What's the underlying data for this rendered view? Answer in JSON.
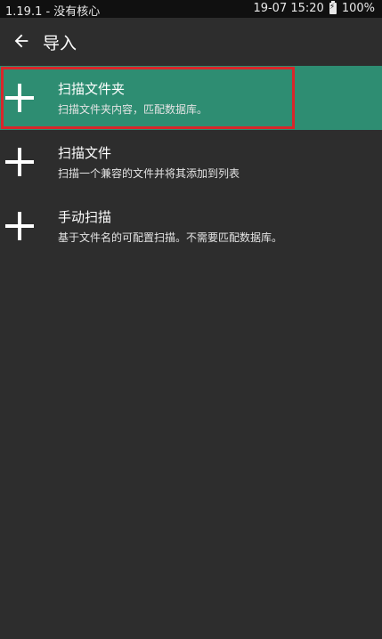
{
  "status_bar": {
    "left_text": "1.19.1 - 没有核心",
    "datetime": "19-07 15:20",
    "battery_icon": "battery-charging-icon",
    "battery": "100%"
  },
  "app_bar": {
    "back_icon": "arrow-left-icon",
    "title": "导入"
  },
  "colors": {
    "background": "#2d2d2d",
    "selected_item": "#2e8d72",
    "highlight_border": "#d8262a"
  },
  "items": [
    {
      "icon": "plus-icon",
      "title": "扫描文件夹",
      "subtitle": "扫描文件夹内容，匹配数据库。",
      "selected": true
    },
    {
      "icon": "plus-icon",
      "title": "扫描文件",
      "subtitle": "扫描一个兼容的文件并将其添加到列表",
      "selected": false
    },
    {
      "icon": "plus-icon",
      "title": "手动扫描",
      "subtitle": "基于文件名的可配置扫描。不需要匹配数据库。",
      "selected": false
    }
  ]
}
